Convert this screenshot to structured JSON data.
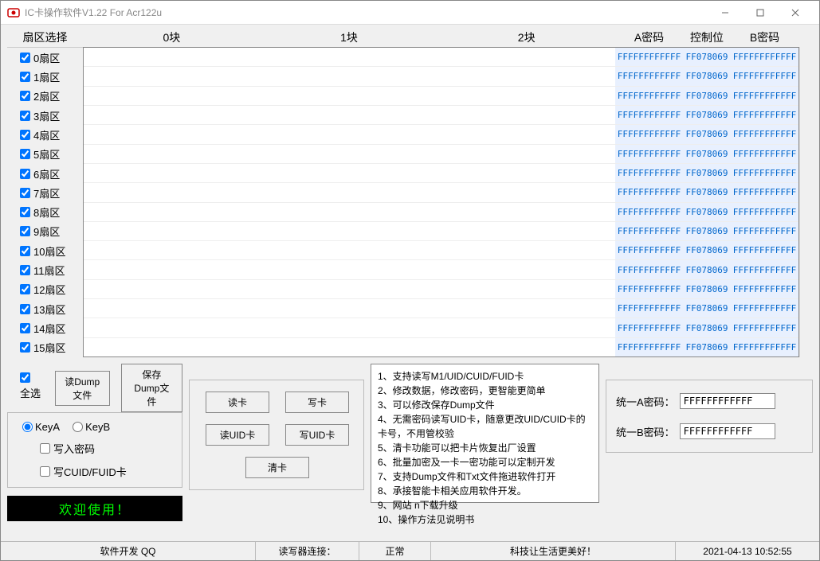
{
  "window": {
    "title": "IC卡操作软件V1.22 For Acr122u"
  },
  "headers": {
    "sector": "扇区选择",
    "block0": "0块",
    "block1": "1块",
    "block2": "2块",
    "apass": "A密码",
    "ctrl": "控制位",
    "bpass": "B密码"
  },
  "sectors": [
    {
      "label": "0扇区"
    },
    {
      "label": "1扇区"
    },
    {
      "label": "2扇区"
    },
    {
      "label": "3扇区"
    },
    {
      "label": "4扇区"
    },
    {
      "label": "5扇区"
    },
    {
      "label": "6扇区"
    },
    {
      "label": "7扇区"
    },
    {
      "label": "8扇区"
    },
    {
      "label": "9扇区"
    },
    {
      "label": "10扇区"
    },
    {
      "label": "11扇区"
    },
    {
      "label": "12扇区"
    },
    {
      "label": "13扇区"
    },
    {
      "label": "14扇区"
    },
    {
      "label": "15扇区"
    }
  ],
  "row_defaults": {
    "a": "FFFFFFFFFFFF",
    "c": "FF078069",
    "b": "FFFFFFFFFFFF"
  },
  "select_all": "全选",
  "dump": {
    "read": "读Dump文件",
    "save": "保存Dump文件"
  },
  "key_panel": {
    "keyA": "KeyA",
    "keyB": "KeyB",
    "write_pw": "写入密码",
    "write_cuid": "写CUID/FUID卡"
  },
  "rw": {
    "read": "读卡",
    "write": "写卡",
    "read_uid": "读UID卡",
    "write_uid": "写UID卡",
    "clear": "清卡"
  },
  "welcome": "欢迎使用！",
  "info_lines": [
    "1、支持读写M1/UID/CUID/FUID卡",
    "2、修改数据，修改密码，更智能更简单",
    "3、可以修改保存Dump文件",
    "4、无需密码读写UID卡，随意更改UID/CUID卡的卡号，不用管校验",
    "5、清卡功能可以把卡片恢复出厂设置",
    "6、批量加密及一卡一密功能可以定制开发",
    "7、支持Dump文件和Txt文件拖进软件打开",
    "8、承接智能卡相关应用软件开发。",
    "9、网站                              n下载升级",
    "10、操作方法见说明书"
  ],
  "unified": {
    "a_label": "统一A密码：",
    "b_label": "统一B密码：",
    "a_value": "FFFFFFFFFFFF",
    "b_value": "FFFFFFFFFFFF"
  },
  "status": {
    "dev": "软件开发    QQ",
    "reader": "读写器连接：",
    "state": "正常",
    "slogan": "科技让生活更美好！",
    "time": "2021-04-13 10:52:55"
  }
}
